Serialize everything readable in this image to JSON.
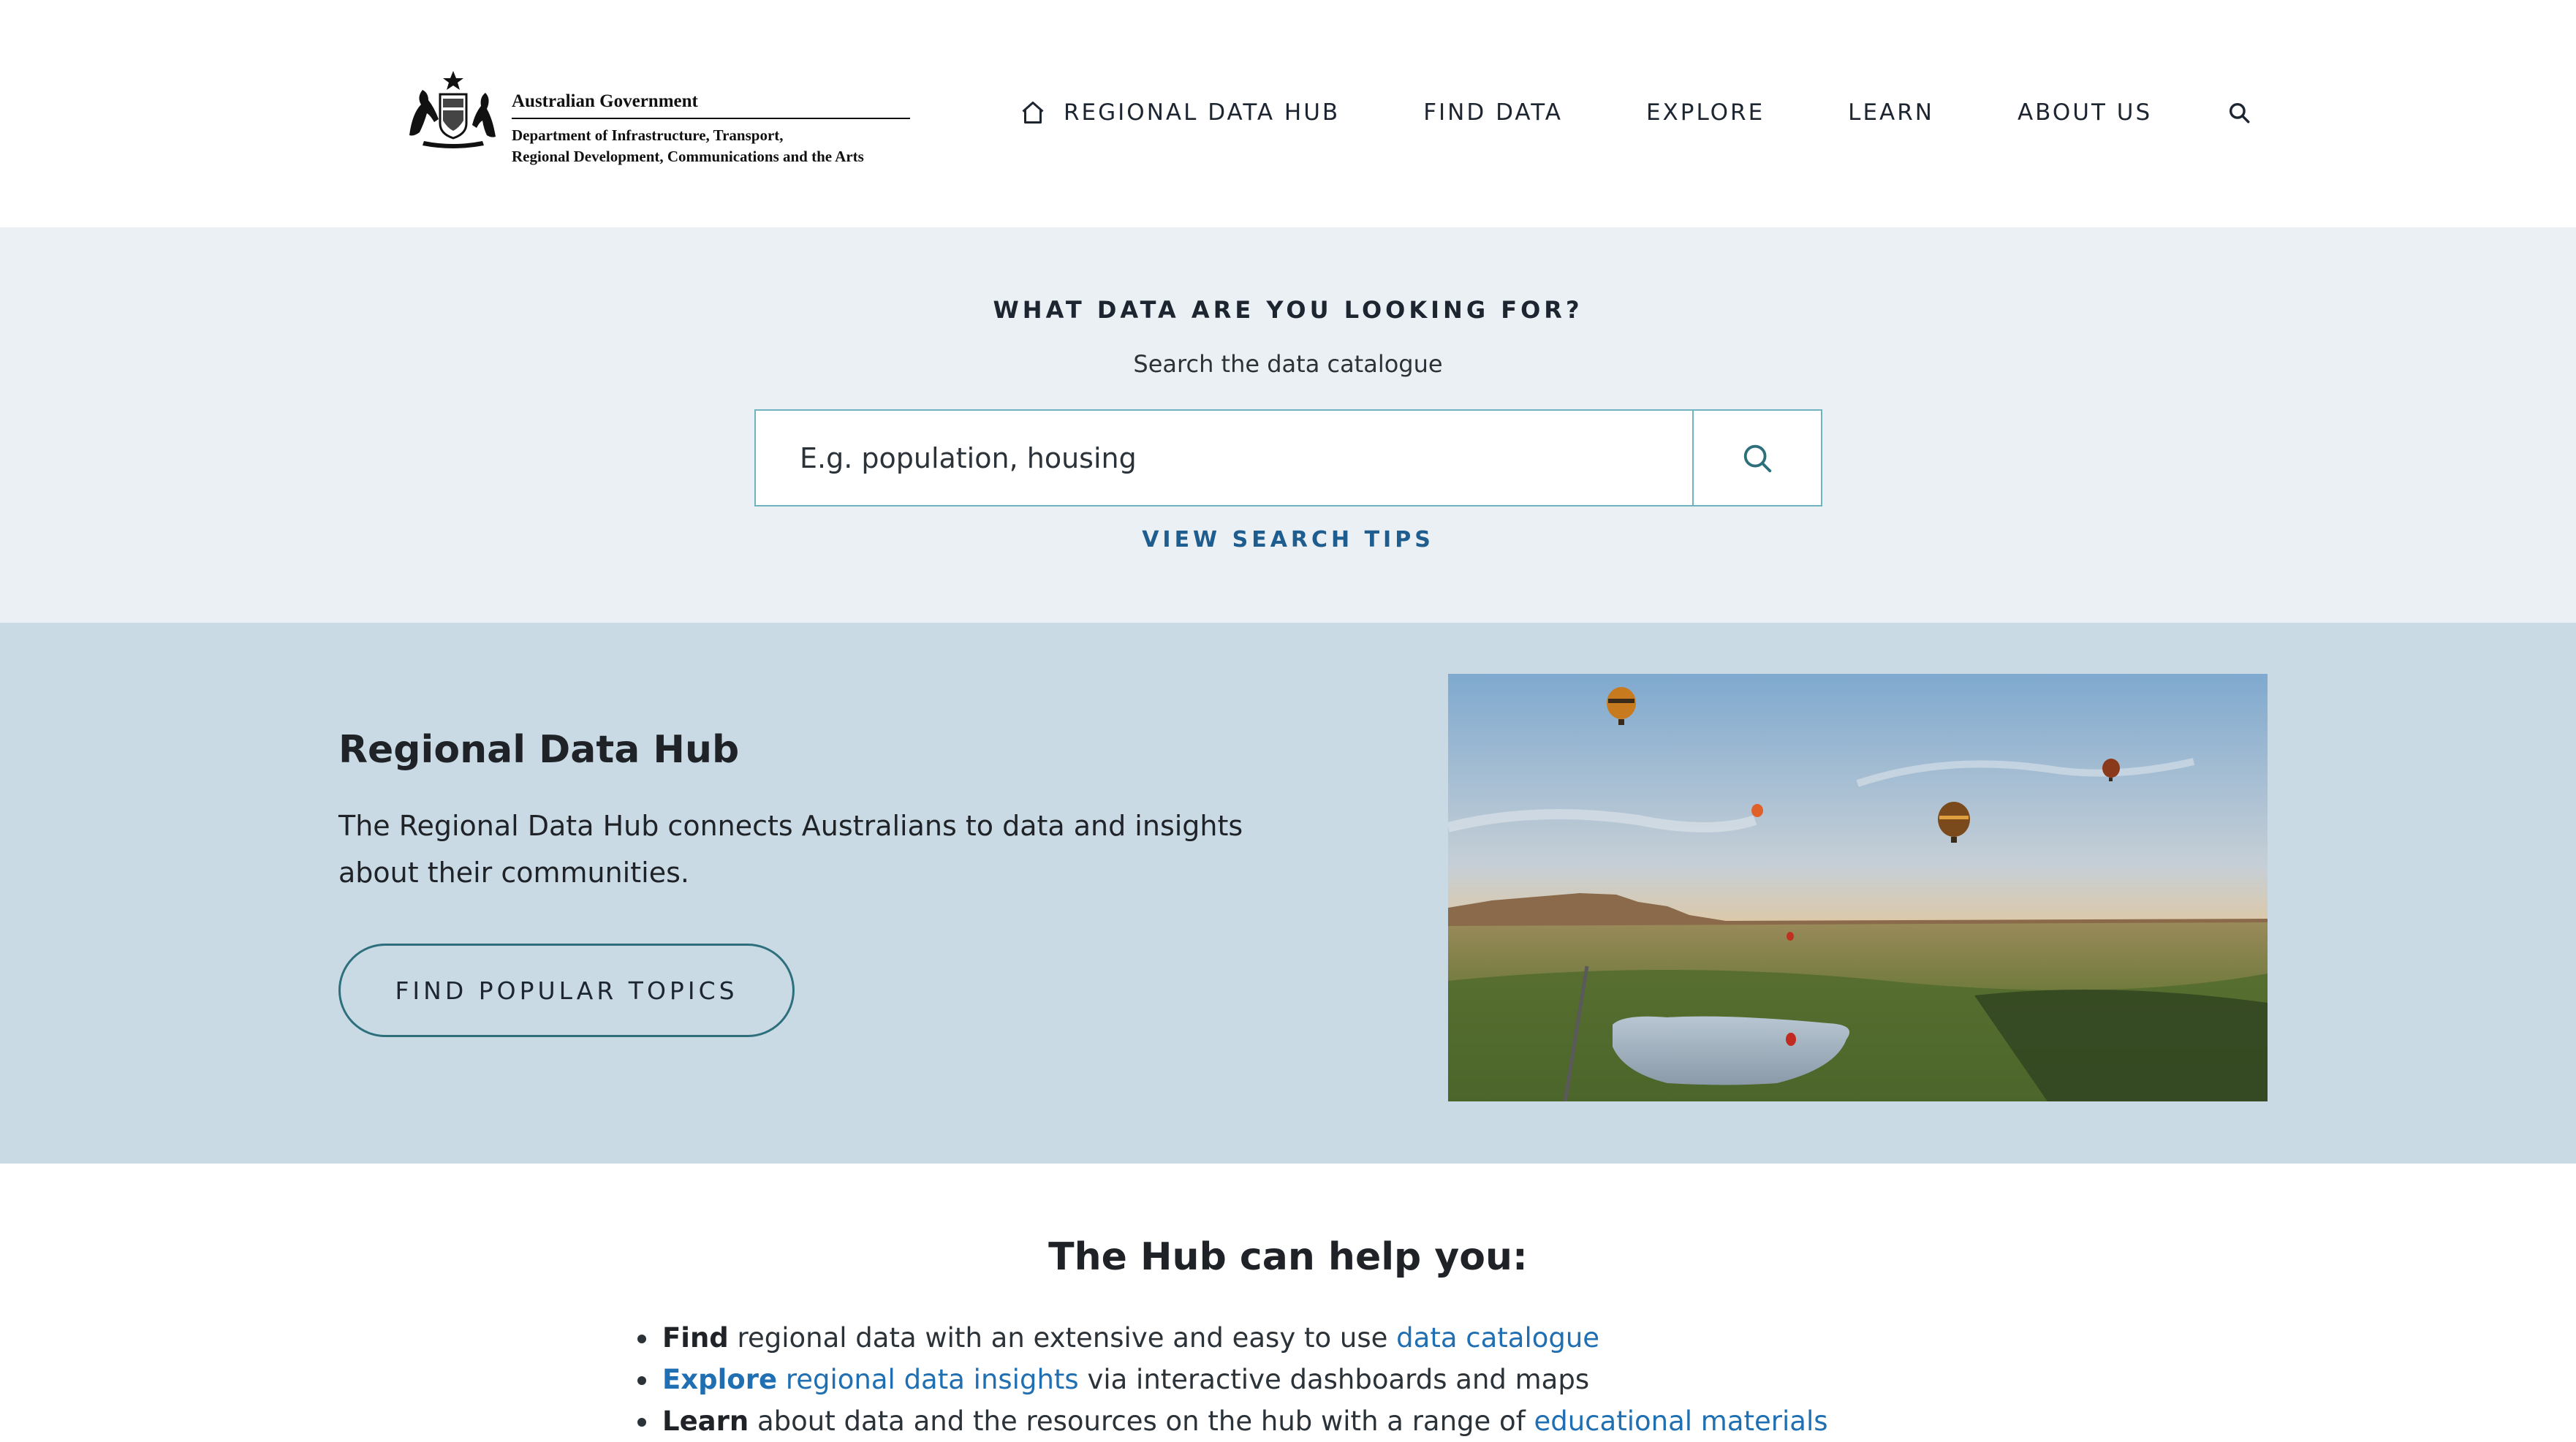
{
  "header": {
    "logo": {
      "government": "Australian Government",
      "department_line1": "Department of Infrastructure, Transport,",
      "department_line2": "Regional Development, Communications and the Arts"
    },
    "nav": {
      "home_label": "REGIONAL DATA HUB",
      "find_label": "FIND DATA",
      "explore_label": "EXPLORE",
      "learn_label": "LEARN",
      "about_label": "ABOUT US"
    }
  },
  "search": {
    "heading": "WHAT DATA ARE YOU LOOKING FOR?",
    "subheading": "Search the data catalogue",
    "placeholder": "E.g. population, housing",
    "tips_label": "VIEW SEARCH TIPS"
  },
  "hero": {
    "title": "Regional Data Hub",
    "text_line1": "The Regional Data Hub connects Australians to data and insights",
    "text_line2": "about their communities.",
    "button_label": "FIND POPULAR TOPICS"
  },
  "help": {
    "title": "The Hub can help you:",
    "items": [
      {
        "lead": "Find",
        "text": " regional data with an extensive and easy to use ",
        "link": "data catalogue"
      },
      {
        "lead": "Explore",
        "link": "regional data insights",
        "text": " via interactive dashboards and maps"
      },
      {
        "lead": "Learn",
        "text": " about data and the resources on the hub with a range of ",
        "link": "educational materials"
      }
    ]
  },
  "colors": {
    "search_band_bg": "#eaf0f4",
    "hero_bg": "#c9dae5",
    "link": "#1f6fb2",
    "accent_teal": "#2e6f7c",
    "search_border": "#6fb3c0"
  },
  "icons": [
    "coat-of-arms-icon",
    "home-icon",
    "search-icon"
  ]
}
